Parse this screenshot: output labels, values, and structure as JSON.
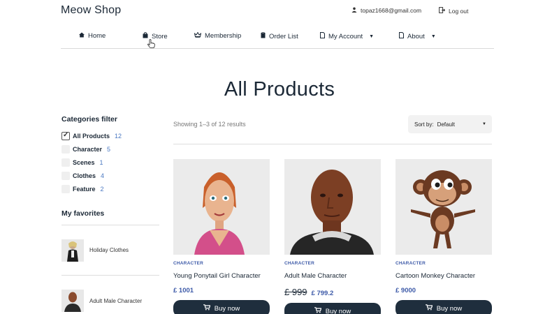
{
  "header": {
    "logo": "Meow Shop",
    "user_email": "topaz1668@gmail.com",
    "logout_label": "Log out"
  },
  "nav": {
    "items": [
      {
        "label": "Home",
        "icon": "home-icon"
      },
      {
        "label": "Store",
        "icon": "bag-icon"
      },
      {
        "label": "Membership",
        "icon": "crown-icon"
      },
      {
        "label": "Order List",
        "icon": "clipboard-icon"
      },
      {
        "label": "My Account",
        "icon": "doc-icon"
      },
      {
        "label": "About",
        "icon": "doc-icon"
      }
    ]
  },
  "page_title": "All Products",
  "sidebar": {
    "categories_heading": "Categories filter",
    "categories": [
      {
        "label": "All Products",
        "count": "12",
        "checked": true
      },
      {
        "label": "Character",
        "count": "5",
        "checked": false
      },
      {
        "label": "Scenes",
        "count": "1",
        "checked": false
      },
      {
        "label": "Clothes",
        "count": "4",
        "checked": false
      },
      {
        "label": "Feature",
        "count": "2",
        "checked": false
      }
    ],
    "favorites_heading": "My favorites",
    "favorites": [
      {
        "label": "Holiday Clothes"
      },
      {
        "label": "Adult Male Character"
      }
    ]
  },
  "toolbar": {
    "results_text": "Showing 1–3 of 12 results",
    "sort_label": "Sort by:",
    "sort_value": "Default"
  },
  "products": [
    {
      "category": "CHARACTER",
      "name": "Young Ponytail Girl Character",
      "price": "£ 1001",
      "old_price": "",
      "buy_label": "Buy now"
    },
    {
      "category": "CHARACTER",
      "name": "Adult Male Character",
      "price": "£ 799.2",
      "old_price": "£ 999",
      "buy_label": "Buy now"
    },
    {
      "category": "CHARACTER",
      "name": "Cartoon Monkey Character",
      "price": "£ 9000",
      "old_price": "",
      "buy_label": "Buy now"
    }
  ],
  "colors": {
    "accent": "#3d5aa8",
    "button": "#1f2e3d",
    "count": "#4a78c2"
  }
}
